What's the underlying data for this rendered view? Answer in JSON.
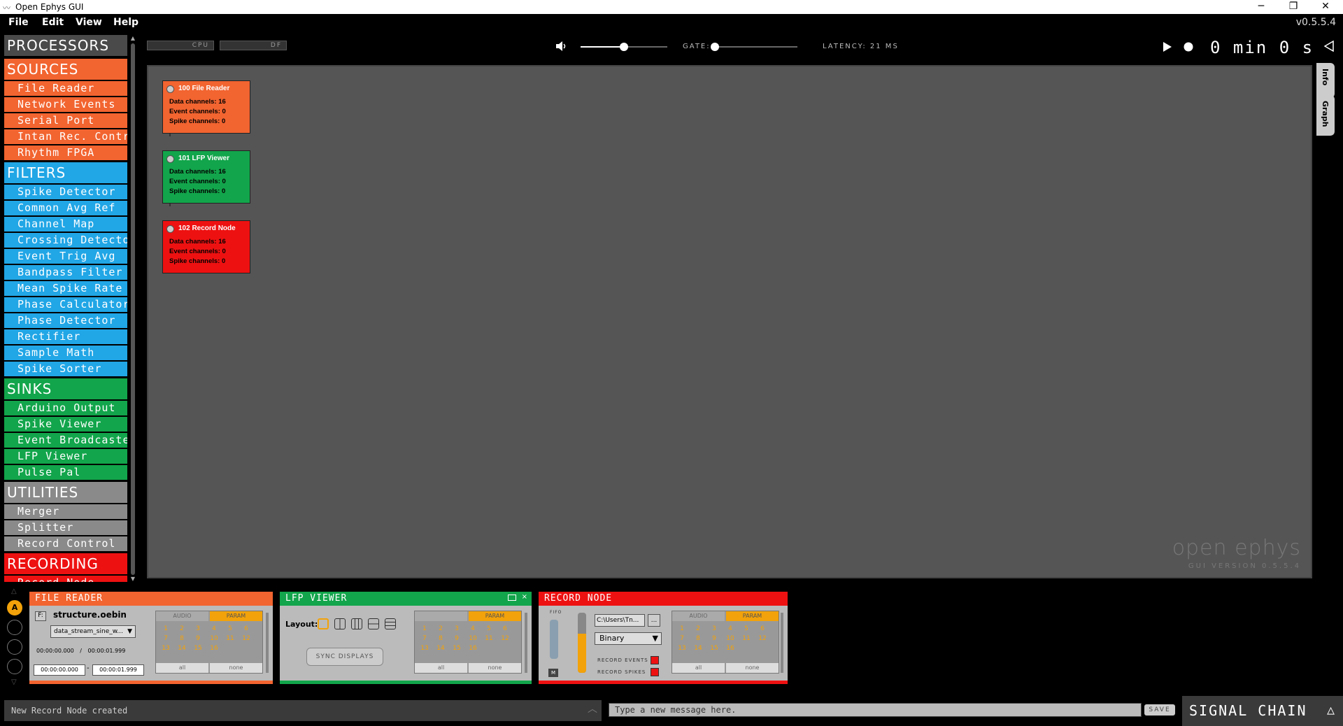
{
  "window": {
    "title": "Open Ephys GUI",
    "buttons": {
      "minimize": "─",
      "restore": "❐",
      "close": "✕"
    }
  },
  "menu": {
    "items": [
      "File",
      "Edit",
      "View",
      "Help"
    ],
    "version": "v0.5.5.4"
  },
  "processors": {
    "header": "PROCESSORS",
    "sources": {
      "label": "SOURCES",
      "items": [
        "File Reader",
        "Network Events",
        "Serial Port",
        "Intan Rec. Controller",
        "Rhythm FPGA"
      ]
    },
    "filters": {
      "label": "FILTERS",
      "items": [
        "Spike Detector",
        "Common Avg Ref",
        "Channel Map",
        "Crossing Detector",
        "Event Trig Avg",
        "Bandpass Filter",
        "Mean Spike Rate",
        "Phase Calculator",
        "Phase Detector",
        "Rectifier",
        "Sample Math",
        "Spike Sorter"
      ]
    },
    "sinks": {
      "label": "SINKS",
      "items": [
        "Arduino Output",
        "Spike Viewer",
        "Event Broadcaster",
        "LFP Viewer",
        "Pulse Pal"
      ]
    },
    "utilities": {
      "label": "UTILITIES",
      "items": [
        "Merger",
        "Splitter",
        "Record Control"
      ]
    },
    "recording": {
      "label": "RECORDING",
      "items": [
        "Record Node"
      ]
    }
  },
  "control_panel": {
    "cpu_label": "CPU",
    "df_label": "DF",
    "volume_level": 0.5,
    "gate_label": "GATE:",
    "gate_level": 0.0,
    "latency": "LATENCY: 21 MS",
    "record_time": "0 min 0 s",
    "icons": {
      "volume": "speaker-icon",
      "play": "play-icon",
      "record": "record-icon",
      "collapse": "triangle-left-icon"
    }
  },
  "graph": {
    "nodes": [
      {
        "title": "100 File Reader",
        "lines": [
          "Data channels: 16",
          "Event channels: 0",
          "Spike channels: 0"
        ]
      },
      {
        "title": "101 LFP Viewer",
        "lines": [
          "Data channels: 16",
          "Event channels: 0",
          "Spike channels: 0"
        ]
      },
      {
        "title": "102 Record Node",
        "lines": [
          "Data channels: 16",
          "Event channels: 0",
          "Spike channels: 0"
        ]
      }
    ],
    "watermark": "open ephys",
    "watermark_version": "GUI VERSION 0.5.5.4"
  },
  "side_tabs": [
    "Info",
    "Graph"
  ],
  "editors": {
    "nav_active": "A",
    "file_reader": {
      "title": "FILE READER",
      "file_btn": "F:",
      "file_name": "structure.oebin",
      "stream": "data_stream_sine_w...",
      "time_start": "00:00:00.000",
      "time_sep": "/",
      "time_end": "00:00:01.999",
      "range_start": "00:00:00.000",
      "range_sep": "-",
      "range_end": "00:00:01.999",
      "tab_audio": "AUDIO",
      "tab_param": "PARAM",
      "btn_all": "all",
      "btn_none": "none"
    },
    "lfp_viewer": {
      "title": "LFP VIEWER",
      "layout_label": "Layout:",
      "sync_btn": "SYNC DISPLAYS",
      "tab_param": "PARAM",
      "btn_all": "all",
      "btn_none": "none"
    },
    "record_node": {
      "title": "RECORD NODE",
      "fifo_label": "FIFO",
      "monitor_btn": "M",
      "path": "C:\\Users\\Tn...",
      "browse_btn": "...",
      "format": "Binary",
      "record_events": "RECORD EVENTS",
      "record_spikes": "RECORD SPIKES",
      "tab_audio": "AUDIO",
      "tab_param": "PARAM",
      "btn_all": "all",
      "btn_none": "none"
    },
    "channels": [
      "1",
      "2",
      "3",
      "4",
      "5",
      "6",
      "7",
      "8",
      "9",
      "10",
      "11",
      "12",
      "13",
      "14",
      "15",
      "16"
    ]
  },
  "bottom": {
    "status": "New Record Node created",
    "message_placeholder": "Type a new message here.",
    "save_btn": "SAVE",
    "signal_chain": "SIGNAL CHAIN"
  },
  "colors": {
    "sources": "#f26430",
    "filters": "#21a6e6",
    "sinks": "#12a54b",
    "utilities": "#8a8a8a",
    "recording": "#ee1111",
    "channel_num": "#f2a20a"
  }
}
